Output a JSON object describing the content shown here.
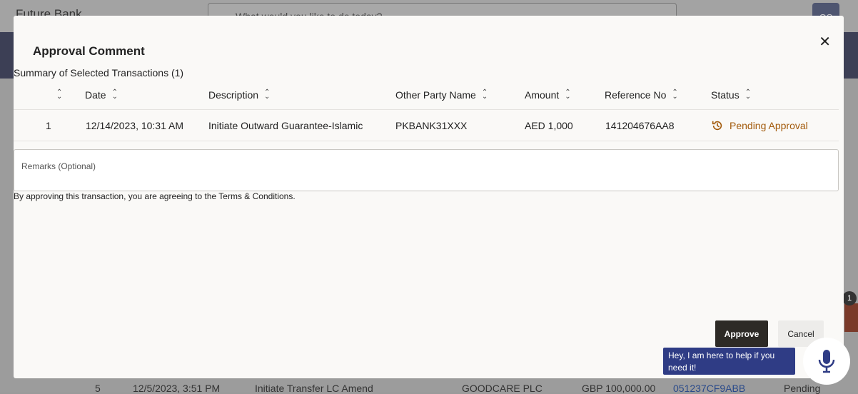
{
  "background": {
    "logo": "Future Bank",
    "search_placeholder": "What would you like to do today?",
    "avatar": "OS",
    "notification_count": "1",
    "row": {
      "index": "5",
      "date": "12/5/2023, 3:51 PM",
      "description": "Initiate Transfer LC Amend",
      "party": "GOODCARE PLC",
      "amount": "GBP 100,000.00",
      "reference": "051237CF9ABB",
      "status": "Pending"
    }
  },
  "modal": {
    "title": "Approval Comment",
    "close_icon": "close-icon",
    "summary": "Summary of Selected Transactions (1)",
    "columns": [
      "",
      "Date",
      "Description",
      "Other Party Name",
      "Amount",
      "Reference No",
      "Status"
    ],
    "rows": [
      {
        "index": "1",
        "date": "12/14/2023, 10:31 AM",
        "description": "Initiate Outward Guarantee-Islamic",
        "party": "PKBANK31XXX",
        "amount": "AED 1,000",
        "reference": "141204676AA8",
        "status": "Pending Approval"
      }
    ],
    "remarks_label": "Remarks (Optional)",
    "terms": "By approving this transaction, you are agreeing to the Terms & Conditions.",
    "approve_label": "Approve",
    "cancel_label": "Cancel",
    "status_color": "#a25a0b"
  },
  "assistant": {
    "message": "Hey, I am here to help if you need it!",
    "icon": "microphone-icon"
  }
}
